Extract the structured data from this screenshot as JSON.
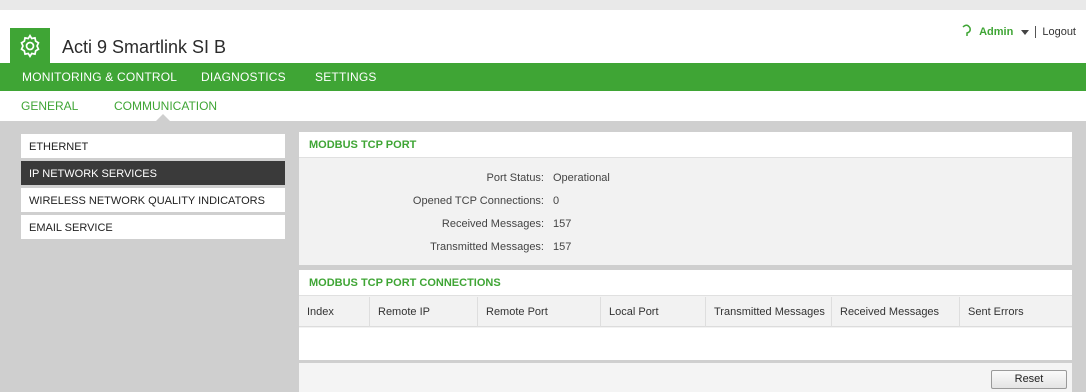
{
  "header": {
    "app_title": "Acti 9 Smartlink SI B",
    "logo_icon": "gear-icon",
    "user_icon": "user-icon",
    "user_name": "Admin",
    "logout_label": "Logout",
    "accent_color": "#3fa535"
  },
  "main_nav": {
    "items": [
      {
        "label": "MONITORING & CONTROL"
      },
      {
        "label": "DIAGNOSTICS"
      },
      {
        "label": "SETTINGS"
      }
    ],
    "active": "DIAGNOSTICS"
  },
  "sub_nav": {
    "items": [
      {
        "label": "GENERAL"
      },
      {
        "label": "COMMUNICATION"
      }
    ],
    "active": "COMMUNICATION"
  },
  "sidebar": {
    "items": [
      {
        "label": "ETHERNET"
      },
      {
        "label": "IP NETWORK SERVICES"
      },
      {
        "label": "WIRELESS NETWORK QUALITY INDICATORS"
      },
      {
        "label": "EMAIL SERVICE"
      }
    ],
    "active": "IP NETWORK SERVICES"
  },
  "modbus_port": {
    "title": "MODBUS TCP PORT",
    "rows": [
      {
        "label": "Port Status:",
        "value": "Operational"
      },
      {
        "label": "Opened TCP Connections:",
        "value": "0"
      },
      {
        "label": "Received Messages:",
        "value": "157"
      },
      {
        "label": "Transmitted Messages:",
        "value": "157"
      }
    ]
  },
  "connections": {
    "title": "MODBUS TCP PORT CONNECTIONS",
    "columns": [
      "Index",
      "Remote IP",
      "Remote Port",
      "Local Port",
      "Transmitted Messages",
      "Received Messages",
      "Sent Errors"
    ],
    "rows": []
  },
  "actions": {
    "reset_label": "Reset"
  }
}
